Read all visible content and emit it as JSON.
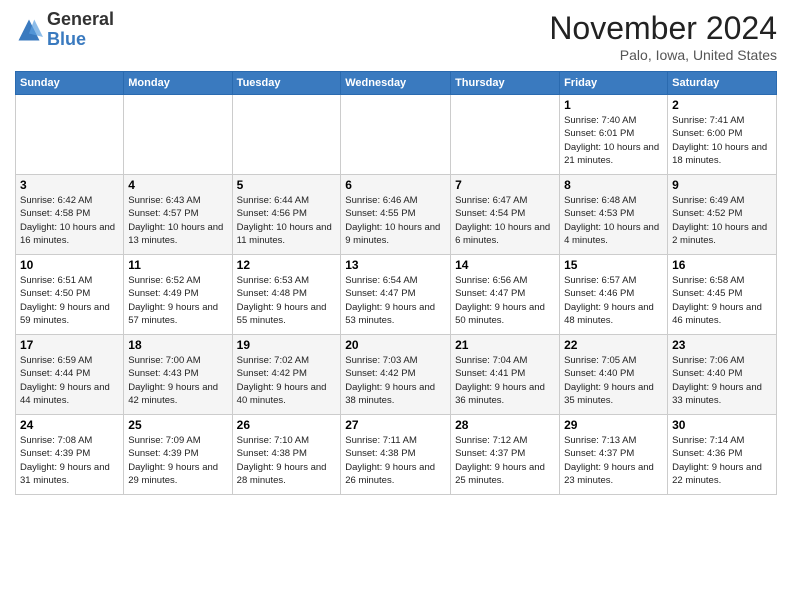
{
  "header": {
    "logo_general": "General",
    "logo_blue": "Blue",
    "month_title": "November 2024",
    "location": "Palo, Iowa, United States"
  },
  "days_of_week": [
    "Sunday",
    "Monday",
    "Tuesday",
    "Wednesday",
    "Thursday",
    "Friday",
    "Saturday"
  ],
  "weeks": [
    [
      {
        "day": "",
        "info": ""
      },
      {
        "day": "",
        "info": ""
      },
      {
        "day": "",
        "info": ""
      },
      {
        "day": "",
        "info": ""
      },
      {
        "day": "",
        "info": ""
      },
      {
        "day": "1",
        "info": "Sunrise: 7:40 AM\nSunset: 6:01 PM\nDaylight: 10 hours and 21 minutes."
      },
      {
        "day": "2",
        "info": "Sunrise: 7:41 AM\nSunset: 6:00 PM\nDaylight: 10 hours and 18 minutes."
      }
    ],
    [
      {
        "day": "3",
        "info": "Sunrise: 6:42 AM\nSunset: 4:58 PM\nDaylight: 10 hours and 16 minutes."
      },
      {
        "day": "4",
        "info": "Sunrise: 6:43 AM\nSunset: 4:57 PM\nDaylight: 10 hours and 13 minutes."
      },
      {
        "day": "5",
        "info": "Sunrise: 6:44 AM\nSunset: 4:56 PM\nDaylight: 10 hours and 11 minutes."
      },
      {
        "day": "6",
        "info": "Sunrise: 6:46 AM\nSunset: 4:55 PM\nDaylight: 10 hours and 9 minutes."
      },
      {
        "day": "7",
        "info": "Sunrise: 6:47 AM\nSunset: 4:54 PM\nDaylight: 10 hours and 6 minutes."
      },
      {
        "day": "8",
        "info": "Sunrise: 6:48 AM\nSunset: 4:53 PM\nDaylight: 10 hours and 4 minutes."
      },
      {
        "day": "9",
        "info": "Sunrise: 6:49 AM\nSunset: 4:52 PM\nDaylight: 10 hours and 2 minutes."
      }
    ],
    [
      {
        "day": "10",
        "info": "Sunrise: 6:51 AM\nSunset: 4:50 PM\nDaylight: 9 hours and 59 minutes."
      },
      {
        "day": "11",
        "info": "Sunrise: 6:52 AM\nSunset: 4:49 PM\nDaylight: 9 hours and 57 minutes."
      },
      {
        "day": "12",
        "info": "Sunrise: 6:53 AM\nSunset: 4:48 PM\nDaylight: 9 hours and 55 minutes."
      },
      {
        "day": "13",
        "info": "Sunrise: 6:54 AM\nSunset: 4:47 PM\nDaylight: 9 hours and 53 minutes."
      },
      {
        "day": "14",
        "info": "Sunrise: 6:56 AM\nSunset: 4:47 PM\nDaylight: 9 hours and 50 minutes."
      },
      {
        "day": "15",
        "info": "Sunrise: 6:57 AM\nSunset: 4:46 PM\nDaylight: 9 hours and 48 minutes."
      },
      {
        "day": "16",
        "info": "Sunrise: 6:58 AM\nSunset: 4:45 PM\nDaylight: 9 hours and 46 minutes."
      }
    ],
    [
      {
        "day": "17",
        "info": "Sunrise: 6:59 AM\nSunset: 4:44 PM\nDaylight: 9 hours and 44 minutes."
      },
      {
        "day": "18",
        "info": "Sunrise: 7:00 AM\nSunset: 4:43 PM\nDaylight: 9 hours and 42 minutes."
      },
      {
        "day": "19",
        "info": "Sunrise: 7:02 AM\nSunset: 4:42 PM\nDaylight: 9 hours and 40 minutes."
      },
      {
        "day": "20",
        "info": "Sunrise: 7:03 AM\nSunset: 4:42 PM\nDaylight: 9 hours and 38 minutes."
      },
      {
        "day": "21",
        "info": "Sunrise: 7:04 AM\nSunset: 4:41 PM\nDaylight: 9 hours and 36 minutes."
      },
      {
        "day": "22",
        "info": "Sunrise: 7:05 AM\nSunset: 4:40 PM\nDaylight: 9 hours and 35 minutes."
      },
      {
        "day": "23",
        "info": "Sunrise: 7:06 AM\nSunset: 4:40 PM\nDaylight: 9 hours and 33 minutes."
      }
    ],
    [
      {
        "day": "24",
        "info": "Sunrise: 7:08 AM\nSunset: 4:39 PM\nDaylight: 9 hours and 31 minutes."
      },
      {
        "day": "25",
        "info": "Sunrise: 7:09 AM\nSunset: 4:39 PM\nDaylight: 9 hours and 29 minutes."
      },
      {
        "day": "26",
        "info": "Sunrise: 7:10 AM\nSunset: 4:38 PM\nDaylight: 9 hours and 28 minutes."
      },
      {
        "day": "27",
        "info": "Sunrise: 7:11 AM\nSunset: 4:38 PM\nDaylight: 9 hours and 26 minutes."
      },
      {
        "day": "28",
        "info": "Sunrise: 7:12 AM\nSunset: 4:37 PM\nDaylight: 9 hours and 25 minutes."
      },
      {
        "day": "29",
        "info": "Sunrise: 7:13 AM\nSunset: 4:37 PM\nDaylight: 9 hours and 23 minutes."
      },
      {
        "day": "30",
        "info": "Sunrise: 7:14 AM\nSunset: 4:36 PM\nDaylight: 9 hours and 22 minutes."
      }
    ]
  ]
}
